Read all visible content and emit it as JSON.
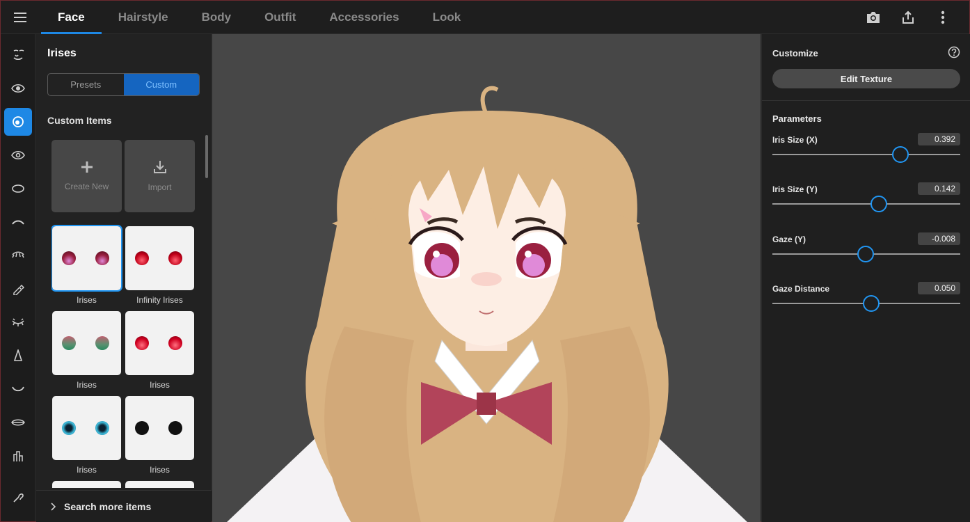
{
  "tabs": [
    {
      "label": "Face",
      "active": true
    },
    {
      "label": "Hairstyle"
    },
    {
      "label": "Body"
    },
    {
      "label": "Outfit"
    },
    {
      "label": "Accessories"
    },
    {
      "label": "Look"
    }
  ],
  "top_actions": [
    "camera-icon",
    "share-icon",
    "more-vertical-icon"
  ],
  "rail_icons": [
    "face-outline-icon",
    "eye-icon",
    "iris-icon",
    "eye-white-icon",
    "eye-shape-icon",
    "eyebrow-icon",
    "eyelash-icon",
    "eyeliner-icon",
    "eyelid-icon",
    "nose-icon",
    "mouth-icon",
    "lips-icon",
    "teeth-icon",
    "ear-icon"
  ],
  "panel": {
    "title": "Irises",
    "seg_presets": "Presets",
    "seg_custom": "Custom",
    "section_title": "Custom Items",
    "create_new": "Create New",
    "import": "Import",
    "search_more": "Search more items",
    "items": [
      {
        "label": "Irises",
        "color_top": "#6a1020",
        "color_bottom": "#e08ad8",
        "selected": true
      },
      {
        "label": "Infinity Irises",
        "color_top": "#b00018",
        "color_bottom": "#ff4050"
      },
      {
        "label": "Irises",
        "color_top": "#b05a6a",
        "color_bottom": "#3aa070"
      },
      {
        "label": "Irises",
        "color_top": "#a00018",
        "color_bottom": "#ff3040"
      },
      {
        "label": "Irises",
        "color_top": "#0a3a5a",
        "color_bottom": "#3ac0e0"
      },
      {
        "label": "Irises",
        "color_top": "#111111",
        "color_bottom": "#222222"
      }
    ]
  },
  "right": {
    "customize": "Customize",
    "edit_texture": "Edit Texture",
    "parameters": "Parameters",
    "params": [
      {
        "name": "Iris Size (X)",
        "value": "0.392",
        "fraction": 0.68
      },
      {
        "name": "Iris Size (Y)",
        "value": "0.142",
        "fraction": 0.565
      },
      {
        "name": "Gaze (Y)",
        "value": "-0.008",
        "fraction": 0.495
      },
      {
        "name": "Gaze Distance",
        "value": "0.050",
        "fraction": 0.525
      }
    ]
  },
  "colors": {
    "accent": "#1e88e5",
    "viewport_bg": "#474747",
    "hair": "#d9b382"
  }
}
